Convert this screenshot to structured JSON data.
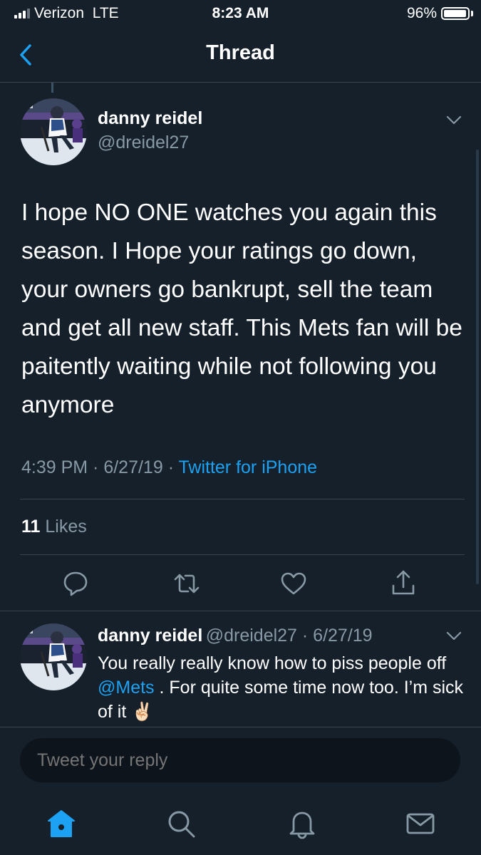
{
  "status_bar": {
    "carrier": "Verizon",
    "network": "LTE",
    "time": "8:23 AM",
    "battery": "96%",
    "battery_level": 0.96
  },
  "nav": {
    "title": "Thread",
    "back_icon": "chevron-left-icon"
  },
  "tweet": {
    "author_name": "danny reidel",
    "handle": "@dreidel27",
    "text": "I hope NO ONE watches you again this season. I Hope your ratings go down, your owners go bankrupt, sell the team and get all new staff. This Mets fan will be paitently waiting while not following you anymore",
    "time": "4:39 PM",
    "date": "6/27/19",
    "source": "Twitter for iPhone",
    "likes_count": "11",
    "likes_label": "Likes"
  },
  "reply": {
    "author_name": "danny reidel",
    "handle_date": "@dreidel27 · 6/27/19",
    "text_before": "You really really know how to piss people off ",
    "mention": "@Mets",
    "text_after": " . For quite some time now too. I’m sick of it ✌🏻"
  },
  "compose": {
    "placeholder": "Tweet your reply"
  },
  "colors": {
    "background": "#15202b",
    "accent": "#1da1f2",
    "secondary_text": "#8899a6",
    "divider": "#38444d"
  }
}
